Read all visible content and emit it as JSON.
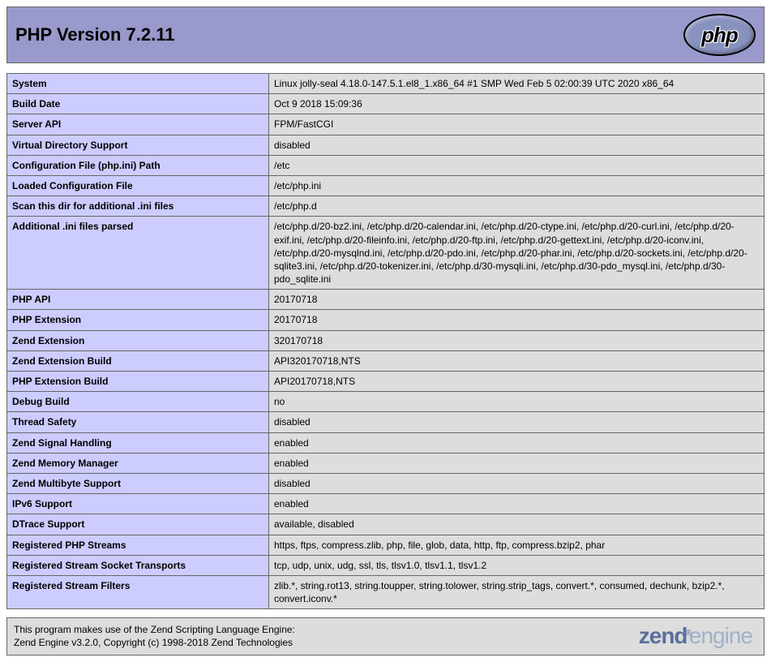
{
  "header": {
    "title": "PHP Version 7.2.11",
    "logo_text": "php"
  },
  "rows": [
    {
      "label": "System",
      "value": "Linux jolly-seal 4.18.0-147.5.1.el8_1.x86_64 #1 SMP Wed Feb 5 02:00:39 UTC 2020 x86_64"
    },
    {
      "label": "Build Date",
      "value": "Oct 9 2018 15:09:36"
    },
    {
      "label": "Server API",
      "value": "FPM/FastCGI"
    },
    {
      "label": "Virtual Directory Support",
      "value": "disabled"
    },
    {
      "label": "Configuration File (php.ini) Path",
      "value": "/etc"
    },
    {
      "label": "Loaded Configuration File",
      "value": "/etc/php.ini"
    },
    {
      "label": "Scan this dir for additional .ini files",
      "value": "/etc/php.d"
    },
    {
      "label": "Additional .ini files parsed",
      "value": "/etc/php.d/20-bz2.ini, /etc/php.d/20-calendar.ini, /etc/php.d/20-ctype.ini, /etc/php.d/20-curl.ini, /etc/php.d/20-exif.ini, /etc/php.d/20-fileinfo.ini, /etc/php.d/20-ftp.ini, /etc/php.d/20-gettext.ini, /etc/php.d/20-iconv.ini, /etc/php.d/20-mysqlnd.ini, /etc/php.d/20-pdo.ini, /etc/php.d/20-phar.ini, /etc/php.d/20-sockets.ini, /etc/php.d/20-sqlite3.ini, /etc/php.d/20-tokenizer.ini, /etc/php.d/30-mysqli.ini, /etc/php.d/30-pdo_mysql.ini, /etc/php.d/30-pdo_sqlite.ini"
    },
    {
      "label": "PHP API",
      "value": "20170718"
    },
    {
      "label": "PHP Extension",
      "value": "20170718"
    },
    {
      "label": "Zend Extension",
      "value": "320170718"
    },
    {
      "label": "Zend Extension Build",
      "value": "API320170718,NTS"
    },
    {
      "label": "PHP Extension Build",
      "value": "API20170718,NTS"
    },
    {
      "label": "Debug Build",
      "value": "no"
    },
    {
      "label": "Thread Safety",
      "value": "disabled"
    },
    {
      "label": "Zend Signal Handling",
      "value": "enabled"
    },
    {
      "label": "Zend Memory Manager",
      "value": "enabled"
    },
    {
      "label": "Zend Multibyte Support",
      "value": "disabled"
    },
    {
      "label": "IPv6 Support",
      "value": "enabled"
    },
    {
      "label": "DTrace Support",
      "value": "available, disabled"
    },
    {
      "label": "Registered PHP Streams",
      "value": "https, ftps, compress.zlib, php, file, glob, data, http, ftp, compress.bzip2, phar"
    },
    {
      "label": "Registered Stream Socket Transports",
      "value": "tcp, udp, unix, udg, ssl, tls, tlsv1.0, tlsv1.1, tlsv1.2"
    },
    {
      "label": "Registered Stream Filters",
      "value": "zlib.*, string.rot13, string.toupper, string.tolower, string.strip_tags, convert.*, consumed, dechunk, bzip2.*, convert.iconv.*"
    }
  ],
  "footer": {
    "line1": "This program makes use of the Zend Scripting Language Engine:",
    "line2": "Zend Engine v3.2.0, Copyright (c) 1998-2018 Zend Technologies",
    "logo_main": "zend",
    "logo_reg": "®",
    "logo_engine": "engine"
  }
}
